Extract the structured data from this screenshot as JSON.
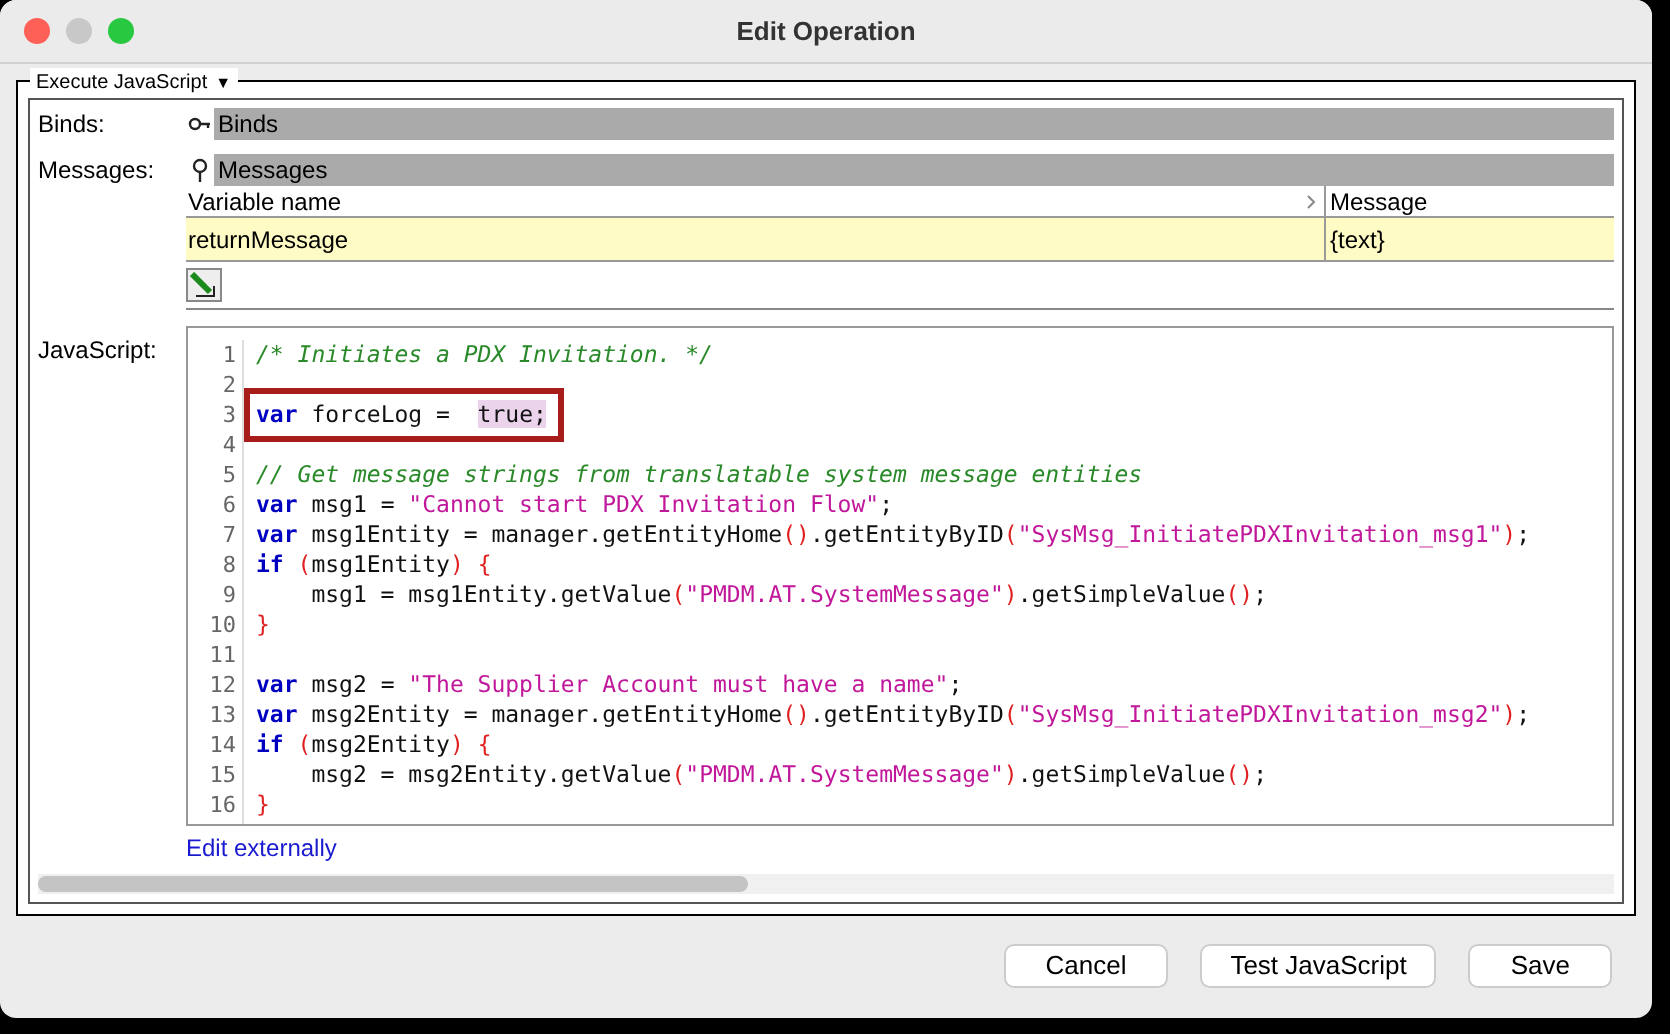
{
  "window": {
    "title": "Edit Operation"
  },
  "section": {
    "title": "Execute JavaScript",
    "dropdown": "▼"
  },
  "binds": {
    "label": "Binds:",
    "header": "Binds"
  },
  "messages": {
    "label": "Messages:",
    "header": "Messages",
    "columns": [
      "Variable name",
      "Message"
    ],
    "rows": [
      {
        "cells": [
          "returnMessage",
          "{text}"
        ],
        "selected": true
      }
    ]
  },
  "javascript": {
    "label": "JavaScript:",
    "link": "Edit externally",
    "lines": [
      {
        "number": "1",
        "boxed": false,
        "tokens": [
          {
            "kind": "comment",
            "text": "/* Initiates a PDX Invitation. */"
          }
        ]
      },
      {
        "number": "2",
        "boxed": false
      },
      {
        "number": "3",
        "boxed": true,
        "tokens": [
          {
            "kind": "keyword",
            "text": "var"
          },
          {
            "kind": "plain",
            "text": " forceLog =  "
          },
          {
            "kind": "match",
            "text": "true;"
          }
        ]
      },
      {
        "number": "4",
        "boxed": false
      },
      {
        "number": "5",
        "boxed": false,
        "tokens": [
          {
            "kind": "comment",
            "text": "// Get message strings from translatable system message entities"
          }
        ]
      },
      {
        "number": "6",
        "boxed": false,
        "tokens": [
          {
            "kind": "keyword",
            "text": "var"
          },
          {
            "kind": "plain",
            "text": " msg1 = "
          },
          {
            "kind": "string",
            "text": "\"Cannot start PDX Invitation Flow\""
          },
          {
            "kind": "plain",
            "text": ";"
          }
        ]
      },
      {
        "number": "7",
        "boxed": false,
        "tokens": [
          {
            "kind": "keyword",
            "text": "var"
          },
          {
            "kind": "plain",
            "text": " msg1Entity = manager.getEntityHome"
          },
          {
            "kind": "paren",
            "text": "()"
          },
          {
            "kind": "plain",
            "text": ".getEntityByID"
          },
          {
            "kind": "paren",
            "text": "("
          },
          {
            "kind": "string",
            "text": "\"SysMsg_InitiatePDXInvitation_msg1\""
          },
          {
            "kind": "paren",
            "text": ")"
          },
          {
            "kind": "plain",
            "text": ";"
          }
        ]
      },
      {
        "number": "8",
        "boxed": false,
        "tokens": [
          {
            "kind": "keyword",
            "text": "if"
          },
          {
            "kind": "paren",
            "text": " ("
          },
          {
            "kind": "plain",
            "text": "msg1Entity"
          },
          {
            "kind": "paren",
            "text": ") {"
          }
        ]
      },
      {
        "number": "9",
        "boxed": false,
        "tokens": [
          {
            "kind": "plain",
            "text": "    msg1 = msg1Entity.getValue"
          },
          {
            "kind": "paren",
            "text": "("
          },
          {
            "kind": "string",
            "text": "\"PMDM.AT.SystemMessage\""
          },
          {
            "kind": "paren",
            "text": ")"
          },
          {
            "kind": "plain",
            "text": ".getSimpleValue"
          },
          {
            "kind": "paren",
            "text": "()"
          },
          {
            "kind": "plain",
            "text": ";"
          }
        ]
      },
      {
        "number": "10",
        "boxed": false,
        "tokens": [
          {
            "kind": "paren",
            "text": "}"
          }
        ]
      },
      {
        "number": "11",
        "boxed": false
      },
      {
        "number": "12",
        "boxed": false,
        "tokens": [
          {
            "kind": "keyword",
            "text": "var"
          },
          {
            "kind": "plain",
            "text": " msg2 = "
          },
          {
            "kind": "string",
            "text": "\"The Supplier Account must have a name\""
          },
          {
            "kind": "plain",
            "text": ";"
          }
        ]
      },
      {
        "number": "13",
        "boxed": false,
        "tokens": [
          {
            "kind": "keyword",
            "text": "var"
          },
          {
            "kind": "plain",
            "text": " msg2Entity = manager.getEntityHome"
          },
          {
            "kind": "paren",
            "text": "()"
          },
          {
            "kind": "plain",
            "text": ".getEntityByID"
          },
          {
            "kind": "paren",
            "text": "("
          },
          {
            "kind": "string",
            "text": "\"SysMsg_InitiatePDXInvitation_msg2\""
          },
          {
            "kind": "paren",
            "text": ")"
          },
          {
            "kind": "plain",
            "text": ";"
          }
        ]
      },
      {
        "number": "14",
        "boxed": false,
        "tokens": [
          {
            "kind": "keyword",
            "text": "if"
          },
          {
            "kind": "paren",
            "text": " ("
          },
          {
            "kind": "plain",
            "text": "msg2Entity"
          },
          {
            "kind": "paren",
            "text": ") {"
          }
        ]
      },
      {
        "number": "15",
        "boxed": false,
        "tokens": [
          {
            "kind": "plain",
            "text": "    msg2 = msg2Entity.getValue"
          },
          {
            "kind": "paren",
            "text": "("
          },
          {
            "kind": "string",
            "text": "\"PMDM.AT.SystemMessage\""
          },
          {
            "kind": "paren",
            "text": ")"
          },
          {
            "kind": "plain",
            "text": ".getSimpleValue"
          },
          {
            "kind": "paren",
            "text": "()"
          },
          {
            "kind": "plain",
            "text": ";"
          }
        ]
      },
      {
        "number": "16",
        "boxed": false,
        "tokens": [
          {
            "kind": "paren",
            "text": "}"
          }
        ]
      }
    ]
  },
  "buttons": [
    "Cancel",
    "Test JavaScript",
    "Save"
  ]
}
